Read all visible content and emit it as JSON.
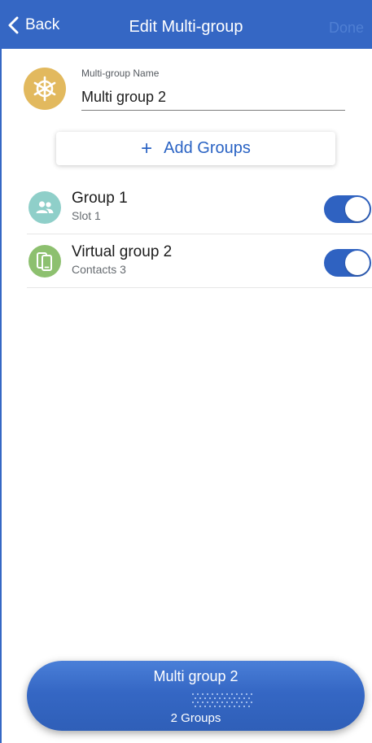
{
  "header": {
    "back_label": "Back",
    "title": "Edit Multi-group",
    "done_label": "Done"
  },
  "form": {
    "icon": "helm-wheel-icon",
    "name_label": "Multi-group Name",
    "name_value": "Multi group 2"
  },
  "add_groups": {
    "icon": "plus-icon",
    "label": "Add Groups"
  },
  "groups": [
    {
      "icon": "people-icon",
      "icon_color": "#8fcfc9",
      "title": "Group 1",
      "subtitle": "Slot 1",
      "enabled": true
    },
    {
      "icon": "devices-icon",
      "icon_color": "#8dc06f",
      "title": "Virtual group 2",
      "subtitle": "Contacts 3",
      "enabled": true
    }
  ],
  "bottom_bar": {
    "title": "Multi group 2",
    "subtitle": "2 Groups"
  },
  "colors": {
    "accent": "#3567c4",
    "toggle_on": "#2f62c1",
    "multigroup_icon": "#e2b95e"
  }
}
